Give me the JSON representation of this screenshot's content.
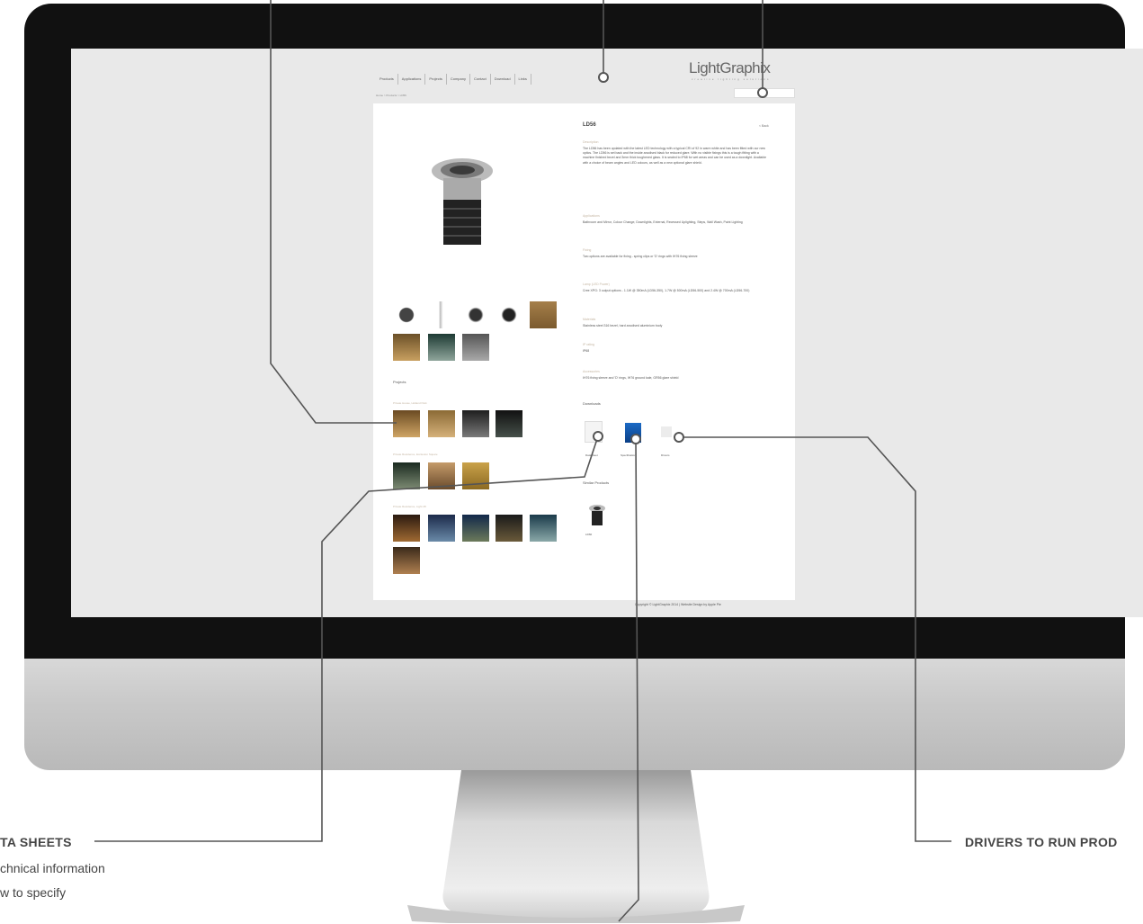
{
  "website": {
    "nav": [
      "Products",
      "Applications",
      "Projects",
      "Company",
      "Contact",
      "Download",
      "Links"
    ],
    "logo": "LightGraphix",
    "logo_tagline": "creative lighting solutions",
    "breadcrumb": "Home > Products > LD56",
    "product": {
      "title": "LD56",
      "back": "< Back",
      "sections": [
        {
          "heading": "Description",
          "text": "The LD56 has been updated with the latest LED technology with a typical CRI of 92 in warm white and has been fitted with our new optics. The LD56 is set back and the inside anodised black for reduced glare. With no visible fixings this is a tough fitting with a machine finished bezel and 3mm thick toughened glass. It is sealed to IP68 for wet areas and can be used as a downlight. Available with a choice of beam angles and LED colours, as well as a new optional glare shield."
        },
        {
          "heading": "Applications",
          "text": "Bathroom and Mirror, Colour Change, Downlights, External, Recessed Uplighting, Steps, Wall Wash, Paint Lighting"
        },
        {
          "heading": "Fixing",
          "text": "Two options are available for fixing - spring clips or 'D' rings with IH76 fixing sleeve"
        },
        {
          "heading": "Lamp (LED Power)",
          "text": "Cree XPG: 3 output options - 1.1W @ 350mA (LD56-350), 1.7W @ 500mA (LD56-500) and 2.4W @ 700mA (LD56-700)"
        },
        {
          "heading": "Materials",
          "text": "Stainless steel 316 bezel, hard anodised aluminium body"
        },
        {
          "heading": "IP rating",
          "text": "IP68"
        },
        {
          "heading": "Accessories",
          "text": "IH76 fixing sleeve and 'D' rings, IH76 ground kale, GR56 glare shield"
        }
      ],
      "downloads_heading": "Downloads",
      "downloads": [
        "Datasheet",
        "Specification",
        "Drivers"
      ],
      "similar_heading": "Similar Products",
      "similar": [
        "LD60"
      ],
      "projects_heading": "Projects",
      "projects": [
        "Private House, Holland Park",
        "Private Residence, Eccleston Square",
        "Private Residence, Light 28"
      ]
    },
    "copyright": "Copyright © LightGraphix 2014 | Website Design by Apple Pie"
  },
  "callouts": {
    "data_sheets_title": "TA SHEETS",
    "data_sheets_line1": "chnical information",
    "data_sheets_line2": "w to specify",
    "drivers_title": "DRIVERS TO RUN PROD"
  },
  "colors": {
    "bezel": "#111111",
    "screen": "#e9e9e9",
    "accent_text": "#c5b6a3",
    "callout_line": "#555555"
  }
}
